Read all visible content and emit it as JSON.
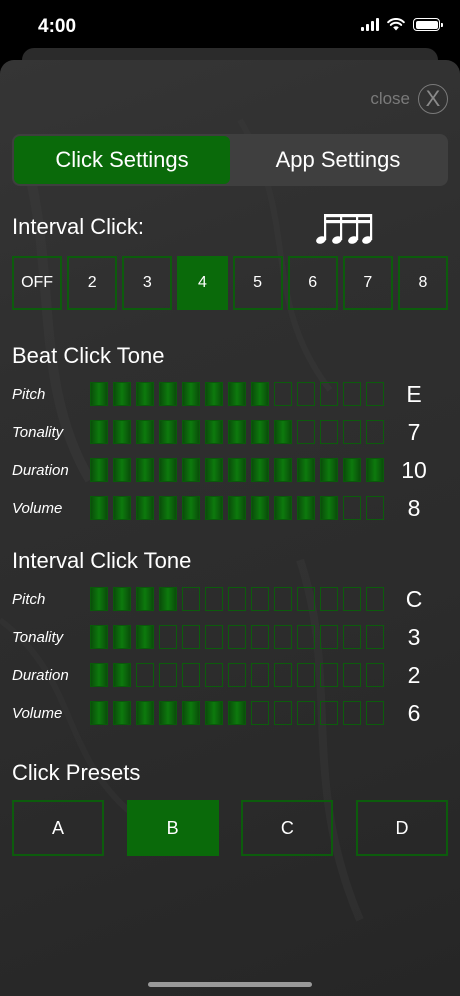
{
  "status": {
    "time": "4:00"
  },
  "header": {
    "close_label": "close",
    "close_icon": "X"
  },
  "tabs": [
    {
      "label": "Click Settings",
      "active": true
    },
    {
      "label": "App Settings",
      "active": false
    }
  ],
  "interval_click": {
    "title": "Interval Click:",
    "options": [
      "OFF",
      "2",
      "3",
      "4",
      "5",
      "6",
      "7",
      "8"
    ],
    "selected": "4"
  },
  "beat_tone": {
    "title": "Beat Click Tone",
    "params": [
      {
        "label": "Pitch",
        "value": "E",
        "level": 8,
        "max": 13
      },
      {
        "label": "Tonality",
        "value": "7",
        "level": 9,
        "max": 13
      },
      {
        "label": "Duration",
        "value": "10",
        "level": 13,
        "max": 13
      },
      {
        "label": "Volume",
        "value": "8",
        "level": 11,
        "max": 13
      }
    ]
  },
  "interval_tone": {
    "title": "Interval Click Tone",
    "params": [
      {
        "label": "Pitch",
        "value": "C",
        "level": 4,
        "max": 13
      },
      {
        "label": "Tonality",
        "value": "3",
        "level": 3,
        "max": 13
      },
      {
        "label": "Duration",
        "value": "2",
        "level": 2,
        "max": 13
      },
      {
        "label": "Volume",
        "value": "6",
        "level": 7,
        "max": 13
      }
    ]
  },
  "presets": {
    "title": "Click Presets",
    "options": [
      "A",
      "B",
      "C",
      "D"
    ],
    "selected": "B"
  },
  "colors": {
    "accent": "#0a6a0a",
    "outline": "#0c5c0c"
  },
  "icons": {
    "notes": "sixteenth-notes-icon"
  }
}
